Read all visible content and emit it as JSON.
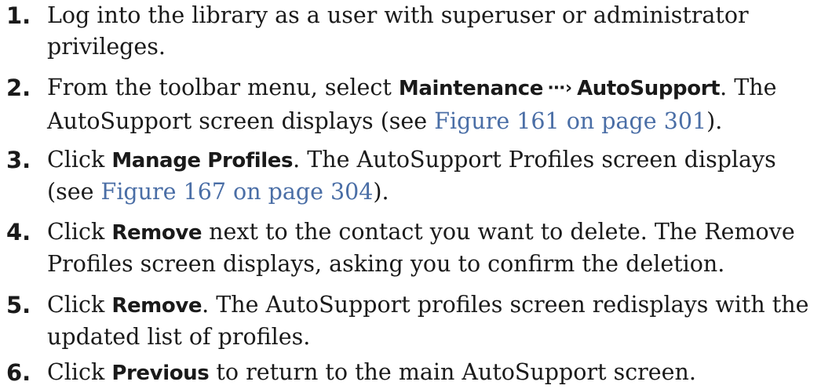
{
  "steps": [
    {
      "number": "1.",
      "text": "Log into the library as a user with superuser or administrator privileges."
    },
    {
      "number": "2.",
      "pre": "From the toolbar menu, select ",
      "menu1": "Maintenance",
      "separator_icon": "dotted-arrow-right-icon",
      "menu2": "AutoSupport",
      "mid": ". The AutoSupport screen displays (see ",
      "link": "Figure 161 on page 301",
      "post": ")."
    },
    {
      "number": "3.",
      "pre": "Click ",
      "ui": "Manage Profiles",
      "mid": ". The AutoSupport Profiles screen displays (see ",
      "link": "Figure 167 on page 304",
      "post": ")."
    },
    {
      "number": "4.",
      "pre": "Click ",
      "ui": "Remove",
      "post": " next to the contact you want to delete. The Remove Profiles screen displays, asking you to confirm the deletion."
    },
    {
      "number": "5.",
      "pre": "Click ",
      "ui": "Remove",
      "post": ". The AutoSupport profiles screen redisplays with the updated list of profiles."
    },
    {
      "number": "6.",
      "pre": "Click ",
      "ui": "Previous",
      "post": " to return to the main AutoSupport screen."
    }
  ],
  "colors": {
    "text": "#1a1a1a",
    "link": "#4a6ea6",
    "background": "#ffffff"
  }
}
